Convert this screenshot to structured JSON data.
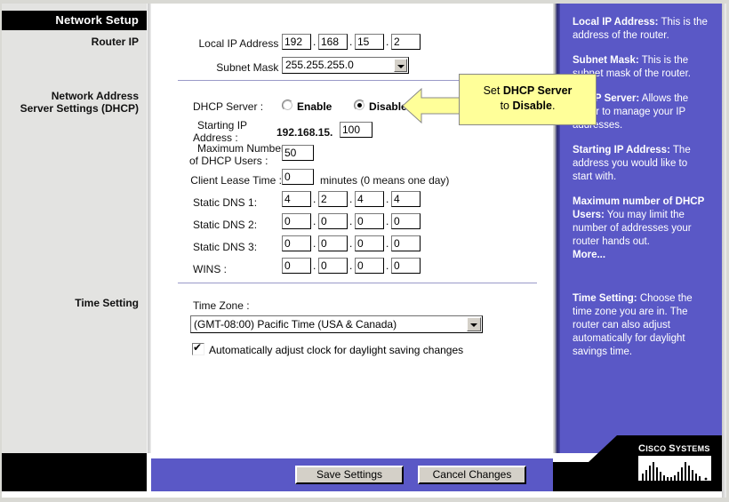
{
  "window": {
    "title": "Network Setup"
  },
  "sidebar": {
    "header": "Network Setup",
    "items": [
      {
        "label": "Router IP"
      },
      {
        "label": "Network Address\nServer Settings (DHCP)"
      },
      {
        "label": "Time Setting"
      }
    ],
    "router_ip": "Router IP",
    "dhcp_line1": "Network Address",
    "dhcp_line2": "Server Settings (DHCP)",
    "time_setting": "Time Setting"
  },
  "form": {
    "local_ip": {
      "label": "Local IP Address :",
      "octets": [
        "192",
        "168",
        "15",
        "2"
      ]
    },
    "subnet_mask": {
      "label": "Subnet Mask :",
      "value": "255.255.255.0"
    },
    "dhcp_server": {
      "label": "DHCP Server :",
      "enable_label": "Enable",
      "disable_label": "Disable",
      "selected": "Disable"
    },
    "starting_ip": {
      "label_line1": "Starting IP",
      "label_line2": "Address :",
      "prefix": "192.168.15.",
      "value": "100"
    },
    "max_users": {
      "label_line1": "Maximum Number",
      "label_line2": "of  DHCP Users :",
      "value": "50"
    },
    "lease_time": {
      "label": "Client Lease Time :",
      "value": "0",
      "suffix": "minutes (0 means one day)"
    },
    "static_dns_1": {
      "label": "Static DNS 1:",
      "octets": [
        "4",
        "2",
        "4",
        "4"
      ]
    },
    "static_dns_2": {
      "label": "Static DNS 2:",
      "octets": [
        "0",
        "0",
        "0",
        "0"
      ]
    },
    "static_dns_3": {
      "label": "Static DNS 3:",
      "octets": [
        "0",
        "0",
        "0",
        "0"
      ]
    },
    "wins": {
      "label": "WINS :",
      "octets": [
        "0",
        "0",
        "0",
        "0"
      ]
    },
    "time_zone": {
      "label": "Time Zone :",
      "value": "(GMT-08:00) Pacific Time (USA & Canada)"
    },
    "daylight": {
      "label": "Automatically adjust clock for daylight saving changes",
      "checked": true
    },
    "separator_dot": "."
  },
  "callout": {
    "line1_plain": "Set ",
    "line1_bold": "DHCP Server",
    "line2_plain": "to ",
    "line2_bold": "Disable",
    "line2_tail": "."
  },
  "help": [
    {
      "term": "Local IP Address:",
      "text": " This is the address of the router."
    },
    {
      "term": "Subnet Mask:",
      "text": " This is the subnet mask of the router."
    },
    {
      "term": "DHCP Server:",
      "text": " Allows the router to manage your IP addresses."
    },
    {
      "term": "Starting IP Address:",
      "text": " The address you would like to start with."
    },
    {
      "term": "Maximum number of DHCP Users:",
      "text": " You may limit the number of addresses your router hands out."
    },
    {
      "term": "More...",
      "text": ""
    },
    {
      "term": "Time Setting:",
      "text": " Choose the time zone you are in. The router can also adjust automatically for daylight savings time."
    }
  ],
  "buttons": {
    "save": "Save Settings",
    "cancel": "Cancel Changes"
  },
  "brand": {
    "name_cisco": "C",
    "name_cisco_rest": "ISCO ",
    "name_systems": "S",
    "name_systems_rest": "YSTEMS"
  },
  "colors": {
    "accent_blue": "#5a58c6",
    "callout_yellow": "#ffff99",
    "sidebar_grey": "#e3e3e1",
    "header_black": "#000000"
  }
}
